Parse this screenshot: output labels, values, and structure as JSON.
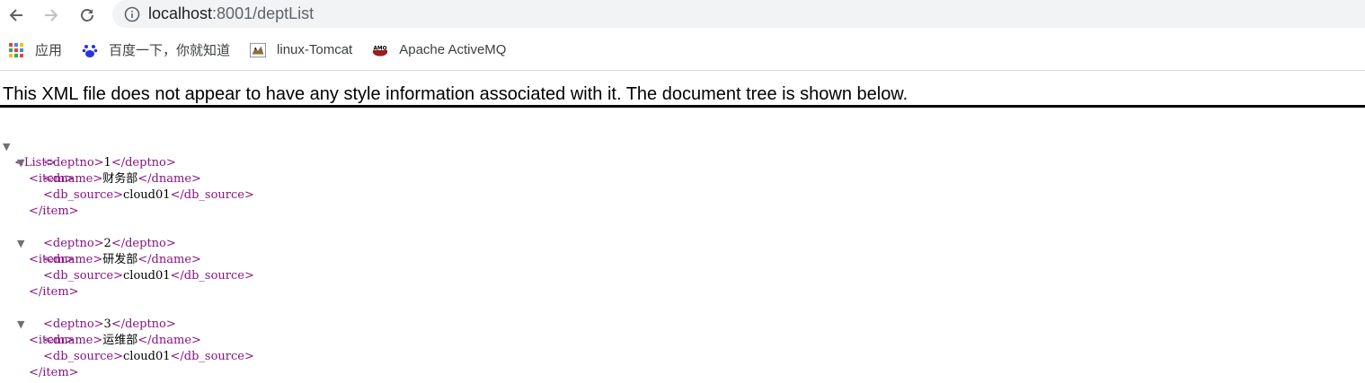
{
  "browser": {
    "url_host": "localhost",
    "url_rest": ":8001/deptList"
  },
  "bookmarks": [
    {
      "label": "应用",
      "icon": "apps-grid-icon"
    },
    {
      "label": "百度一下，你就知道",
      "icon": "baidu-paw-icon"
    },
    {
      "label": "linux-Tomcat",
      "icon": "tomcat-icon"
    },
    {
      "label": "Apache ActiveMQ",
      "icon": "activemq-icon"
    }
  ],
  "notice": "This XML file does not appear to have any style information associated with it. The document tree is shown below.",
  "xml": {
    "root_open": "<List>",
    "items": [
      {
        "open": "<item>",
        "deptno": {
          "open": "<deptno>",
          "value": "1",
          "close": "</deptno>"
        },
        "dname": {
          "open": "<dname>",
          "value": "财务部",
          "close": "</dname>"
        },
        "db_source": {
          "open": "<db_source>",
          "value": "cloud01",
          "close": "</db_source>"
        },
        "close": "</item>"
      },
      {
        "open": "<item>",
        "deptno": {
          "open": "<deptno>",
          "value": "2",
          "close": "</deptno>"
        },
        "dname": {
          "open": "<dname>",
          "value": "研发部",
          "close": "</dname>"
        },
        "db_source": {
          "open": "<db_source>",
          "value": "cloud01",
          "close": "</db_source>"
        },
        "close": "</item>"
      },
      {
        "open": "<item>",
        "deptno": {
          "open": "<deptno>",
          "value": "3",
          "close": "</deptno>"
        },
        "dname": {
          "open": "<dname>",
          "value": "运维部",
          "close": "</dname>"
        },
        "db_source": {
          "open": "<db_source>",
          "value": "cloud01",
          "close": "</db_source>"
        },
        "close": "</item>"
      }
    ]
  },
  "colors": {
    "tag": "#881280",
    "text": "#000000",
    "omnibox_bg": "#f1f3f4"
  }
}
